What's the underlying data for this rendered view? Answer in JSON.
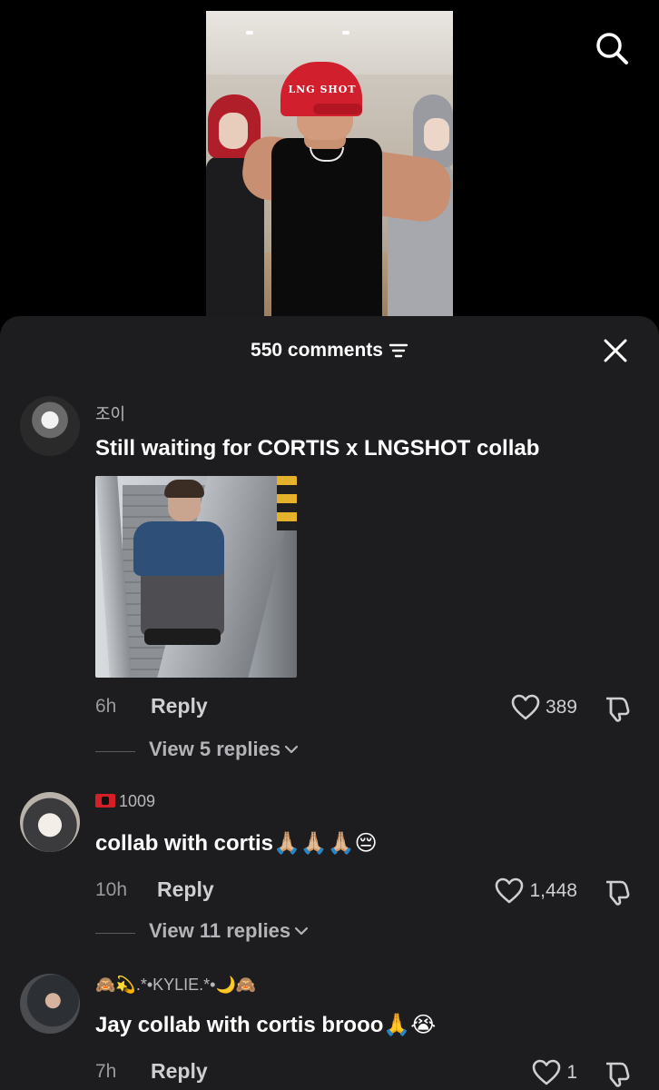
{
  "search": {
    "icon": "search-icon"
  },
  "sheet": {
    "comments_count": "550 comments",
    "sort_icon": "sort-icon",
    "close_icon": "close-icon"
  },
  "video": {
    "cap_text": "LNG SHOT"
  },
  "comments": [
    {
      "username": "조이",
      "text": "Still waiting for CORTIS x LNGSHOT collab",
      "has_image": true,
      "time": "6h",
      "reply_label": "Reply",
      "likes": "389",
      "view_replies": "View 5 replies"
    },
    {
      "username": "1009",
      "username_prefix_flag": "albania-flag",
      "text": "collab with cortis🙏🏼🙏🏼🙏🏼😔",
      "time": "10h",
      "reply_label": "Reply",
      "likes": "1,448",
      "view_replies": "View 11 replies"
    },
    {
      "username": "🙈💫.*•KYLIE.*•🌙🙈",
      "text": "Jay collab with cortis brooo🙏😭",
      "time": "7h",
      "reply_label": "Reply",
      "likes": "1"
    }
  ],
  "colors": {
    "background": "#000000",
    "sheet": "#1d1d1f",
    "primary_text": "#ffffff",
    "secondary_text": "#9a9a9d"
  }
}
